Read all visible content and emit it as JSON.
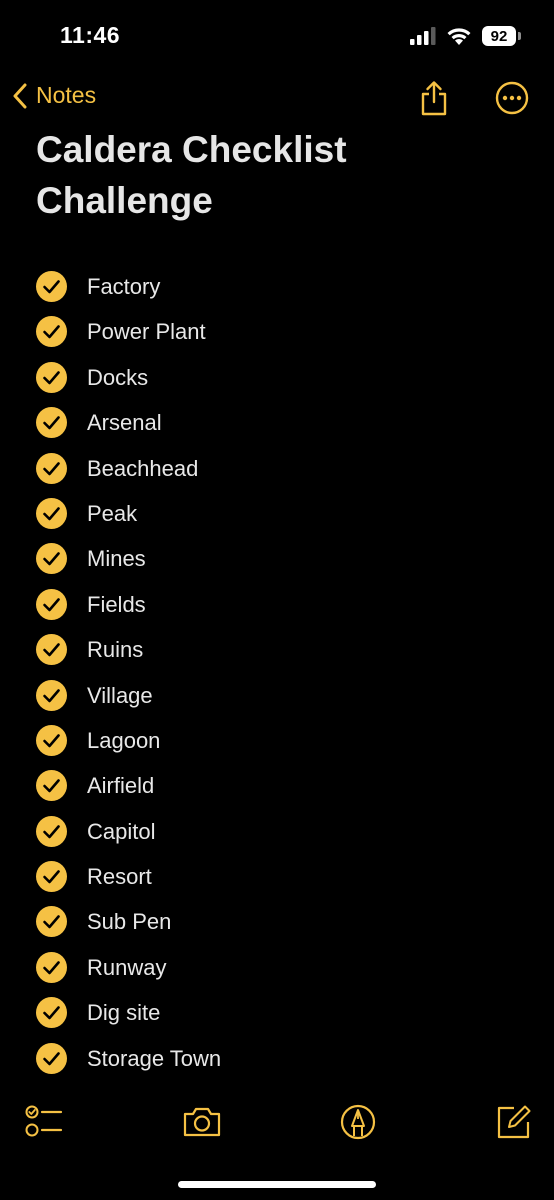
{
  "status_bar": {
    "time": "11:46",
    "battery": "92",
    "icons": [
      "cellular-signal-icon",
      "wifi-icon",
      "battery-icon"
    ]
  },
  "nav": {
    "back_label": "Notes",
    "icons": [
      "chevron-left-icon",
      "share-icon",
      "more-icon"
    ]
  },
  "note": {
    "title": "Caldera Checklist Challenge",
    "items": [
      {
        "label": "Factory",
        "checked": true
      },
      {
        "label": "Power Plant",
        "checked": true
      },
      {
        "label": "Docks",
        "checked": true
      },
      {
        "label": "Arsenal",
        "checked": true
      },
      {
        "label": "Beachhead",
        "checked": true
      },
      {
        "label": "Peak",
        "checked": true
      },
      {
        "label": "Mines",
        "checked": true
      },
      {
        "label": "Fields",
        "checked": true
      },
      {
        "label": "Ruins",
        "checked": true
      },
      {
        "label": "Village",
        "checked": true
      },
      {
        "label": "Lagoon",
        "checked": true
      },
      {
        "label": "Airfield",
        "checked": true
      },
      {
        "label": "Capitol",
        "checked": true
      },
      {
        "label": "Resort",
        "checked": true
      },
      {
        "label": "Sub Pen",
        "checked": true
      },
      {
        "label": "Runway",
        "checked": true
      },
      {
        "label": "Dig site",
        "checked": true
      },
      {
        "label": "Storage Town",
        "checked": true
      }
    ]
  },
  "toolbar": {
    "icons": [
      "checklist-icon",
      "camera-icon",
      "markup-pen-icon",
      "compose-icon"
    ]
  },
  "colors": {
    "accent": "#f5c144",
    "background": "#000000",
    "text": "#e8e8e8"
  }
}
